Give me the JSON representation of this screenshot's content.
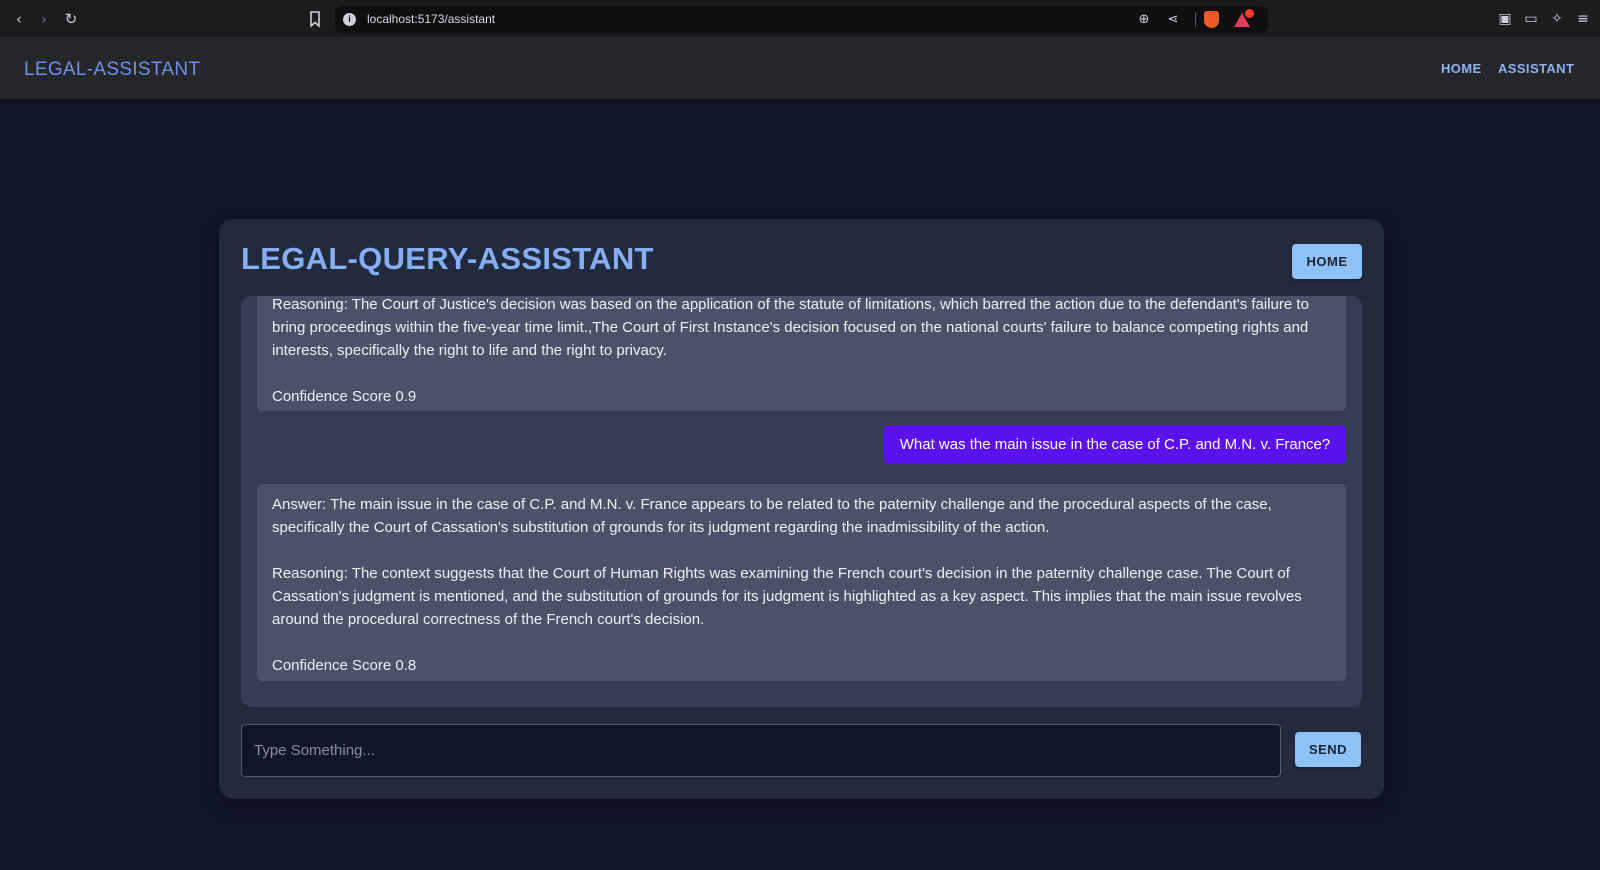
{
  "browser": {
    "url": "localhost:5173/assistant",
    "back_icon": "‹",
    "forward_icon": "›",
    "reload_icon": "↻",
    "bookmark_icon": "bookmark-icon",
    "info_icon": "i",
    "zoom_icon": "⊕",
    "share_icon": "⋖",
    "sidebar_icon": "▣",
    "wallet_icon": "▭",
    "leo_icon": "✧",
    "menu_icon": "≡"
  },
  "nav": {
    "brand": "LEGAL-ASSISTANT",
    "links": [
      "HOME",
      "ASSISTANT"
    ]
  },
  "card": {
    "title": "LEGAL-QUERY-ASSISTANT",
    "home_button": "HOME"
  },
  "messages": [
    {
      "role": "assistant",
      "paragraphs": [
        "Reasoning: The Court of Justice's decision was based on the application of the statute of limitations, which barred the action due to the defendant's failure to bring proceedings within the five-year time limit.,The Court of First Instance's decision focused on the national courts' failure to balance competing rights and interests, specifically the right to life and the right to privacy.",
        "Confidence Score 0.9"
      ]
    },
    {
      "role": "user",
      "text": "What was the main issue in the case of C.P. and M.N. v. France?"
    },
    {
      "role": "assistant",
      "paragraphs": [
        "Answer: The main issue in the case of C.P. and M.N. v. France appears to be related to the paternity challenge and the procedural aspects of the case, specifically the Court of Cassation's substitution of grounds for its judgment regarding the inadmissibility of the action.",
        "Reasoning: The context suggests that the Court of Human Rights was examining the French court's decision in the paternity challenge case. The Court of Cassation's judgment is mentioned, and the substitution of grounds for its judgment is highlighted as a key aspect. This implies that the main issue revolves around the procedural correctness of the French court's decision.",
        "Confidence Score 0.8"
      ]
    }
  ],
  "composer": {
    "placeholder": "Type Something...",
    "value": "",
    "send_label": "SEND"
  },
  "colors": {
    "background": "#111629",
    "card": "#222a3e",
    "accent": "#8ec1f5",
    "user_bubble": "#5a12ef",
    "title": "#86aef5"
  }
}
